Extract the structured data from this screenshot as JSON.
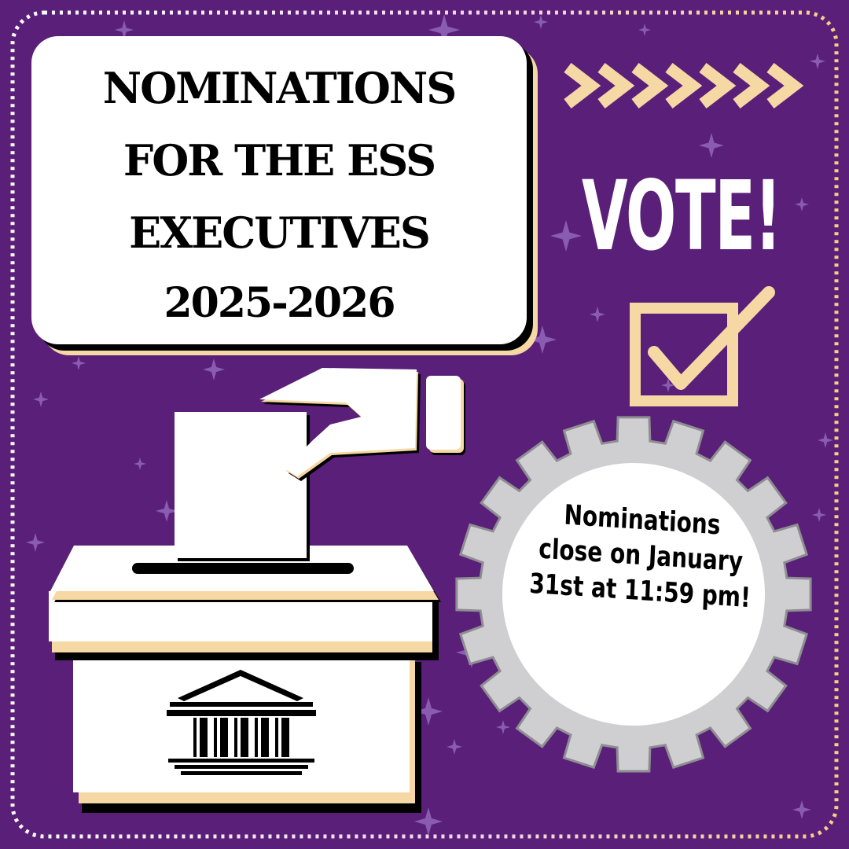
{
  "poster": {
    "title_lines": [
      "NOMINATIONS",
      "FOR THE ESS",
      "EXECUTIVES",
      "2025-2026"
    ],
    "vote_label": "VOTE!",
    "deadline_lines": [
      "Nominations",
      "close on January",
      "31st at 11:59 pm!"
    ],
    "icons": [
      "chevron-arrows-icon",
      "checkbox-check-icon",
      "hand-ballot-icon",
      "ballot-box-icon",
      "building-columns-icon",
      "gear-badge-icon",
      "sparkle-star-icon"
    ]
  },
  "colors": {
    "background": "#5a1f78",
    "box_fill": "#ffffff",
    "accent_cream": "#f6d8a4",
    "outline_shadow": "#000000",
    "gear_gray": "#cfcfd2",
    "border_dots": "#ffffff",
    "star_lavender": "#9a72c4"
  }
}
